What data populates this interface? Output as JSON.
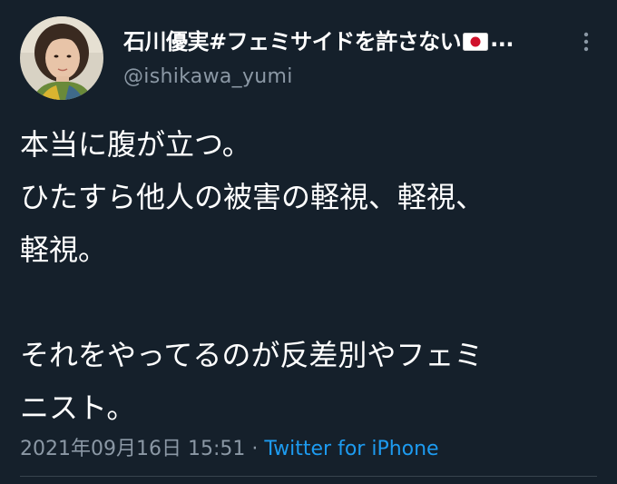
{
  "author": {
    "display_name": "石川優実#フェミサイドを許さない",
    "flag_emoji": "japan-flag-icon",
    "truncation": "...",
    "handle": "@ishikawa_yumi"
  },
  "tweet": {
    "lines": [
      "本当に腹が立つ。",
      "ひたすら他人の被害の軽視、軽視、",
      "軽視。",
      "",
      "それをやってるのが反差別やフェミ",
      "ニスト。"
    ]
  },
  "meta": {
    "timestamp": "2021年09月16日 15:51",
    "separator": " · ",
    "source": "Twitter for iPhone"
  },
  "colors": {
    "background": "#15202b",
    "text": "#ffffff",
    "secondary_text": "#8b98a5",
    "link": "#1d9bf0",
    "divider": "#38444d"
  }
}
